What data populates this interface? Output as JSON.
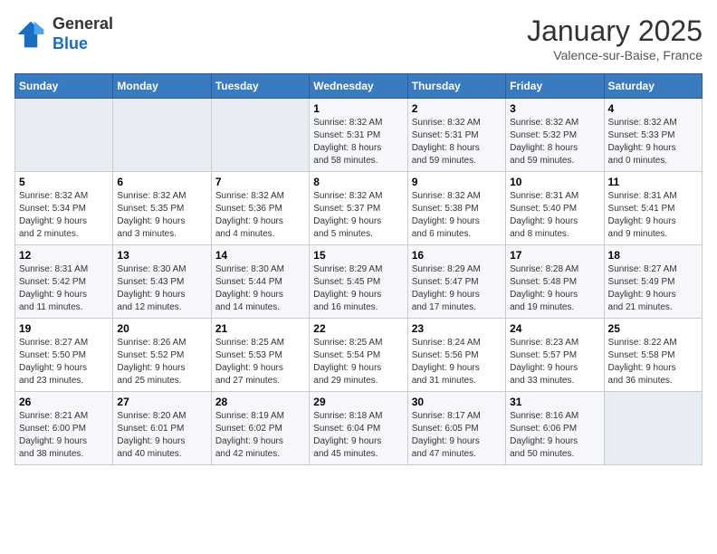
{
  "header": {
    "logo_general": "General",
    "logo_blue": "Blue",
    "month_title": "January 2025",
    "subtitle": "Valence-sur-Baise, France"
  },
  "weekdays": [
    "Sunday",
    "Monday",
    "Tuesday",
    "Wednesday",
    "Thursday",
    "Friday",
    "Saturday"
  ],
  "weeks": [
    [
      {
        "day": "",
        "info": ""
      },
      {
        "day": "",
        "info": ""
      },
      {
        "day": "",
        "info": ""
      },
      {
        "day": "1",
        "info": "Sunrise: 8:32 AM\nSunset: 5:31 PM\nDaylight: 8 hours\nand 58 minutes."
      },
      {
        "day": "2",
        "info": "Sunrise: 8:32 AM\nSunset: 5:31 PM\nDaylight: 8 hours\nand 59 minutes."
      },
      {
        "day": "3",
        "info": "Sunrise: 8:32 AM\nSunset: 5:32 PM\nDaylight: 8 hours\nand 59 minutes."
      },
      {
        "day": "4",
        "info": "Sunrise: 8:32 AM\nSunset: 5:33 PM\nDaylight: 9 hours\nand 0 minutes."
      }
    ],
    [
      {
        "day": "5",
        "info": "Sunrise: 8:32 AM\nSunset: 5:34 PM\nDaylight: 9 hours\nand 2 minutes."
      },
      {
        "day": "6",
        "info": "Sunrise: 8:32 AM\nSunset: 5:35 PM\nDaylight: 9 hours\nand 3 minutes."
      },
      {
        "day": "7",
        "info": "Sunrise: 8:32 AM\nSunset: 5:36 PM\nDaylight: 9 hours\nand 4 minutes."
      },
      {
        "day": "8",
        "info": "Sunrise: 8:32 AM\nSunset: 5:37 PM\nDaylight: 9 hours\nand 5 minutes."
      },
      {
        "day": "9",
        "info": "Sunrise: 8:32 AM\nSunset: 5:38 PM\nDaylight: 9 hours\nand 6 minutes."
      },
      {
        "day": "10",
        "info": "Sunrise: 8:31 AM\nSunset: 5:40 PM\nDaylight: 9 hours\nand 8 minutes."
      },
      {
        "day": "11",
        "info": "Sunrise: 8:31 AM\nSunset: 5:41 PM\nDaylight: 9 hours\nand 9 minutes."
      }
    ],
    [
      {
        "day": "12",
        "info": "Sunrise: 8:31 AM\nSunset: 5:42 PM\nDaylight: 9 hours\nand 11 minutes."
      },
      {
        "day": "13",
        "info": "Sunrise: 8:30 AM\nSunset: 5:43 PM\nDaylight: 9 hours\nand 12 minutes."
      },
      {
        "day": "14",
        "info": "Sunrise: 8:30 AM\nSunset: 5:44 PM\nDaylight: 9 hours\nand 14 minutes."
      },
      {
        "day": "15",
        "info": "Sunrise: 8:29 AM\nSunset: 5:45 PM\nDaylight: 9 hours\nand 16 minutes."
      },
      {
        "day": "16",
        "info": "Sunrise: 8:29 AM\nSunset: 5:47 PM\nDaylight: 9 hours\nand 17 minutes."
      },
      {
        "day": "17",
        "info": "Sunrise: 8:28 AM\nSunset: 5:48 PM\nDaylight: 9 hours\nand 19 minutes."
      },
      {
        "day": "18",
        "info": "Sunrise: 8:27 AM\nSunset: 5:49 PM\nDaylight: 9 hours\nand 21 minutes."
      }
    ],
    [
      {
        "day": "19",
        "info": "Sunrise: 8:27 AM\nSunset: 5:50 PM\nDaylight: 9 hours\nand 23 minutes."
      },
      {
        "day": "20",
        "info": "Sunrise: 8:26 AM\nSunset: 5:52 PM\nDaylight: 9 hours\nand 25 minutes."
      },
      {
        "day": "21",
        "info": "Sunrise: 8:25 AM\nSunset: 5:53 PM\nDaylight: 9 hours\nand 27 minutes."
      },
      {
        "day": "22",
        "info": "Sunrise: 8:25 AM\nSunset: 5:54 PM\nDaylight: 9 hours\nand 29 minutes."
      },
      {
        "day": "23",
        "info": "Sunrise: 8:24 AM\nSunset: 5:56 PM\nDaylight: 9 hours\nand 31 minutes."
      },
      {
        "day": "24",
        "info": "Sunrise: 8:23 AM\nSunset: 5:57 PM\nDaylight: 9 hours\nand 33 minutes."
      },
      {
        "day": "25",
        "info": "Sunrise: 8:22 AM\nSunset: 5:58 PM\nDaylight: 9 hours\nand 36 minutes."
      }
    ],
    [
      {
        "day": "26",
        "info": "Sunrise: 8:21 AM\nSunset: 6:00 PM\nDaylight: 9 hours\nand 38 minutes."
      },
      {
        "day": "27",
        "info": "Sunrise: 8:20 AM\nSunset: 6:01 PM\nDaylight: 9 hours\nand 40 minutes."
      },
      {
        "day": "28",
        "info": "Sunrise: 8:19 AM\nSunset: 6:02 PM\nDaylight: 9 hours\nand 42 minutes."
      },
      {
        "day": "29",
        "info": "Sunrise: 8:18 AM\nSunset: 6:04 PM\nDaylight: 9 hours\nand 45 minutes."
      },
      {
        "day": "30",
        "info": "Sunrise: 8:17 AM\nSunset: 6:05 PM\nDaylight: 9 hours\nand 47 minutes."
      },
      {
        "day": "31",
        "info": "Sunrise: 8:16 AM\nSunset: 6:06 PM\nDaylight: 9 hours\nand 50 minutes."
      },
      {
        "day": "",
        "info": ""
      }
    ]
  ]
}
